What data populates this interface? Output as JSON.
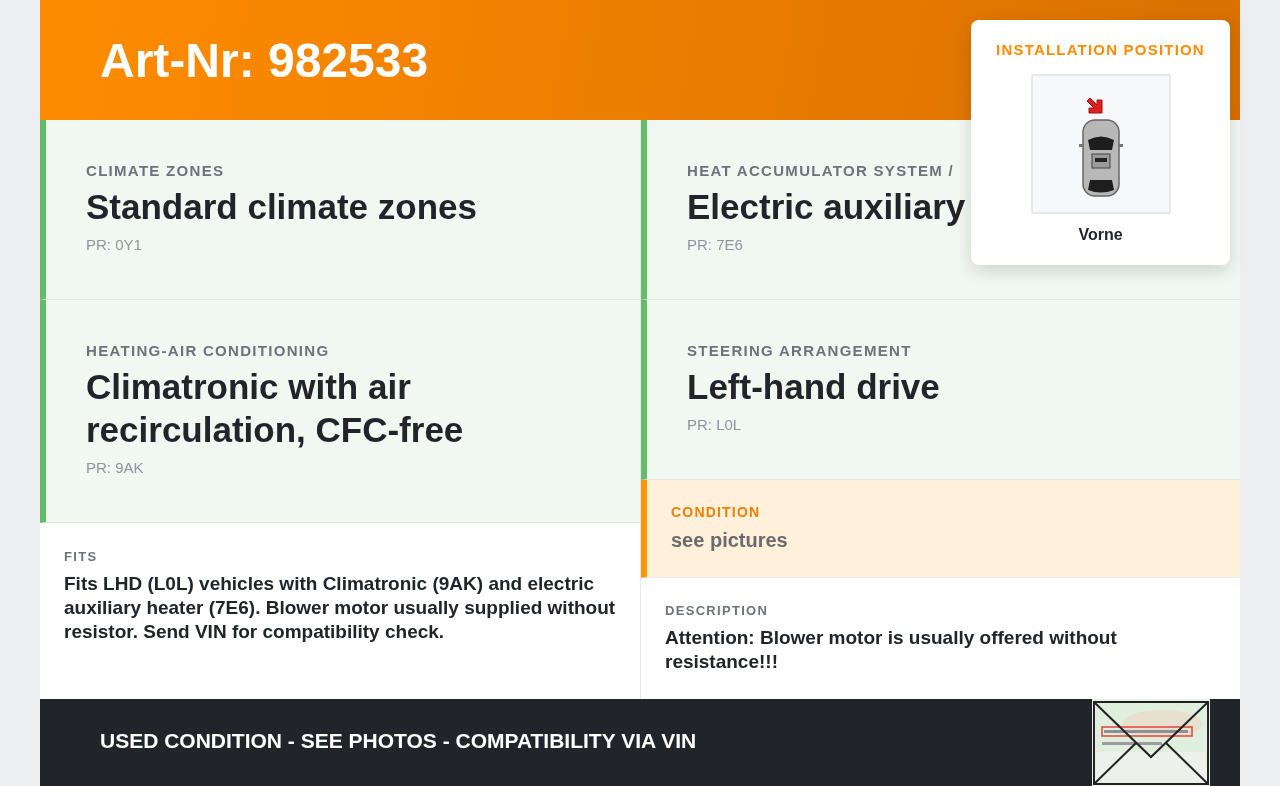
{
  "header": {
    "title": "Art-Nr: 982533"
  },
  "installation_position": {
    "title": "INSTALLATION POSITION",
    "caption": "Vorne"
  },
  "left_column": [
    {
      "kind": "option",
      "label": "CLIMATE ZONES",
      "value": "Standard climate zones",
      "code": "PR: 0Y1"
    },
    {
      "kind": "option",
      "label": "HEATING-AIR CONDITIONING",
      "value": "Climatronic with air recirculation, CFC-free",
      "code": "PR: 9AK"
    },
    {
      "kind": "text",
      "label": "FITS",
      "text": "Fits LHD (L0L) vehicles with Climatronic (9AK) and electric auxiliary heater (7E6). Blower motor usually supplied without resistor. Send VIN for compatibility check."
    }
  ],
  "right_column": [
    {
      "kind": "option",
      "label": "HEAT ACCUMULATOR SYSTEM /",
      "value": "Electric auxiliary",
      "code": "PR: 7E6"
    },
    {
      "kind": "option",
      "label": "STEERING ARRANGEMENT",
      "value": "Left-hand drive",
      "code": "PR: L0L"
    },
    {
      "kind": "condition",
      "label": "CONDITION",
      "value": "see pictures"
    },
    {
      "kind": "text",
      "label": "DESCRIPTION",
      "text": "Attention: Blower motor is usually offered without resistance!!!"
    }
  ],
  "footer": {
    "text": "USED CONDITION - SEE PHOTOS - COMPATIBILITY VIA VIN"
  }
}
